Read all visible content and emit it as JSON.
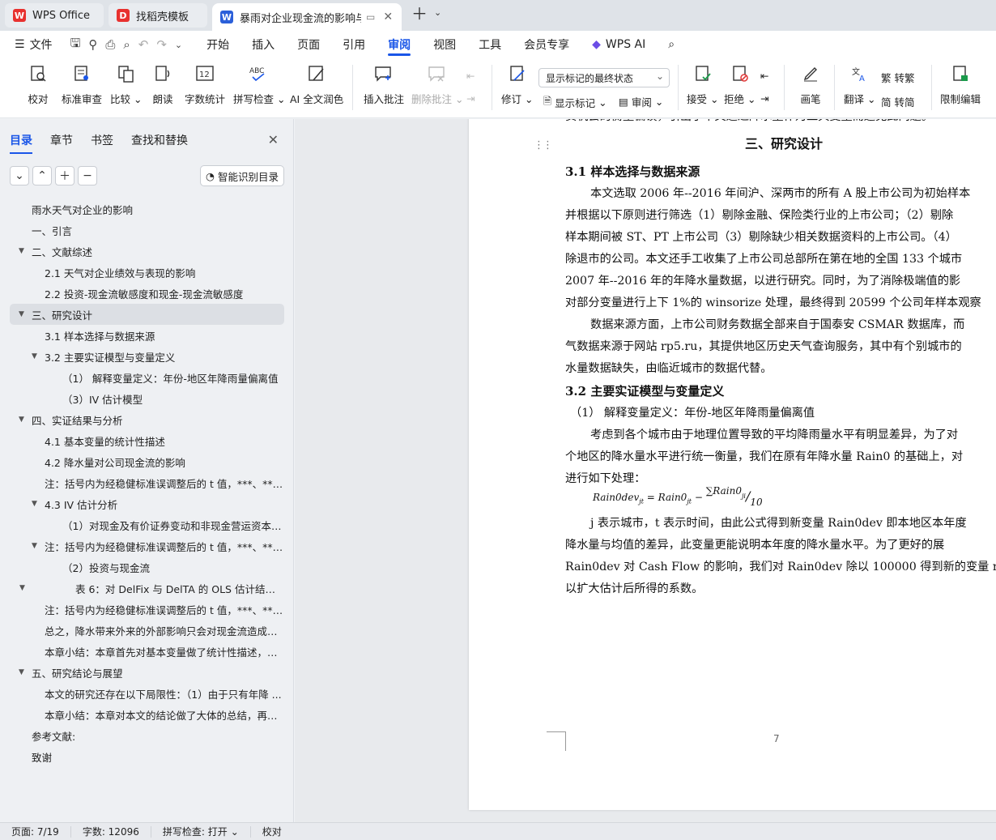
{
  "tabs": [
    {
      "label": "WPS Office",
      "icon": "wps-logo",
      "color": "#e8312f"
    },
    {
      "label": "找稻壳模板",
      "icon": "docer-logo",
      "color": "#e8312f"
    },
    {
      "label": "暴雨对企业现金流的影响与企",
      "icon": "word-doc",
      "color": "#2b5fd9"
    }
  ],
  "menu": {
    "file": "文件",
    "items": [
      "开始",
      "插入",
      "页面",
      "引用",
      "审阅",
      "视图",
      "工具",
      "会员专享"
    ],
    "active": "审阅",
    "wps_ai": "WPS AI"
  },
  "ribbon": {
    "proofread": "校对",
    "standard_review": "标准审查",
    "compare": "比较",
    "read_aloud": "朗读",
    "word_count": "字数统计",
    "spell_check": "拼写检查",
    "ai_polish": "AI 全文润色",
    "insert_comment": "插入批注",
    "delete_comment": "删除批注",
    "track": "修订",
    "markup_select": "显示标记的最终状态",
    "show_markup": "显示标记",
    "review": "审阅",
    "accept": "接受",
    "reject": "拒绝",
    "pen": "画笔",
    "translate": "翻译",
    "to_traditional": "转繁",
    "to_simplified": "转简",
    "restrict_edit": "限制编辑",
    "more": "文"
  },
  "panel": {
    "tabs": [
      "目录",
      "章节",
      "书签",
      "查找和替换"
    ],
    "active_tab": "目录",
    "smart_toc": "智能识别目录",
    "toc": [
      {
        "text": "雨水天气对企业的影响",
        "level": 0,
        "arrow": ""
      },
      {
        "text": "一、引言",
        "level": 0,
        "arrow": ""
      },
      {
        "text": "二、文献综述",
        "level": 0,
        "arrow": "down"
      },
      {
        "text": "2.1 天气对企业绩效与表现的影响",
        "level": 1,
        "arrow": ""
      },
      {
        "text": "2.2 投资-现金流敏感度和现金-现金流敏感度",
        "level": 1,
        "arrow": ""
      },
      {
        "text": "三、研究设计",
        "level": 0,
        "arrow": "down",
        "selected": true
      },
      {
        "text": "3.1  样本选择与数据来源",
        "level": 1,
        "arrow": ""
      },
      {
        "text": "3.2  主要实证模型与变量定义",
        "level": 1,
        "arrow": "down"
      },
      {
        "text": "（1）  解释变量定义：年份-地区年降雨量偏离值",
        "level": 2,
        "arrow": ""
      },
      {
        "text": "（3）IV 估计模型",
        "level": 2,
        "arrow": ""
      },
      {
        "text": "四、实证结果与分析",
        "level": 0,
        "arrow": "down"
      },
      {
        "text": "4.1 基本变量的统计性描述",
        "level": 1,
        "arrow": ""
      },
      {
        "text": "4.2 降水量对公司现金流的影响",
        "level": 1,
        "arrow": ""
      },
      {
        "text": "注：括号内为经稳健标准误调整后的 t 值，***、** ...",
        "level": 1,
        "arrow": ""
      },
      {
        "text": "4.3 IV 估计分析",
        "level": 1,
        "arrow": "down"
      },
      {
        "text": "（1）对现金及有价证券变动和非现金营运资本变 ...",
        "level": 2,
        "arrow": ""
      },
      {
        "text": "注：括号内为经稳健标准误调整后的 t 值，***、** ...",
        "level": 1,
        "arrow": "down"
      },
      {
        "text": "（2）投资与现金流",
        "level": 2,
        "arrow": ""
      },
      {
        "text": "表 6：对 DelFix 与 DelTA 的 OLS 估计结果 ...",
        "level": 3,
        "arrow": "down-far"
      },
      {
        "text": "注：括号内为经稳健标准误调整后的 t 值，***、** ...",
        "level": 1,
        "arrow": ""
      },
      {
        "text": "总之，降水带来外来的外部影响只会对现金流造成正 ...",
        "level": 1,
        "arrow": ""
      },
      {
        "text": "本章小结：本章首先对基本变量做了统计性描述，之 ...",
        "level": 1,
        "arrow": ""
      },
      {
        "text": "五、研究结论与展望",
        "level": 0,
        "arrow": "down"
      },
      {
        "text": "本文的研究还存在以下局限性：（1）由于只有年降 ...",
        "level": 1,
        "arrow": ""
      },
      {
        "text": "本章小结：本章对本文的结论做了大体的总结，再次 ...",
        "level": 1,
        "arrow": ""
      },
      {
        "text": "参考文献:",
        "level": 0,
        "arrow": ""
      },
      {
        "text": "致谢",
        "level": 0,
        "arrow": ""
      }
    ]
  },
  "doc": {
    "top_cut": "货机会的衡量偏误，引出了本文通过降水量作为工具变量而避免此问题。",
    "h_chapter": "三、研究设计",
    "h31": "3.1 样本选择与数据来源",
    "p1": [
      "本文选取 2006 年--2016 年间沪、深两市的所有 A 股上市公司为初始样本",
      "并根据以下原则进行筛选（1）剔除金融、保险类行业的上市公司；（2）剔除",
      "样本期间被 ST、PT 上市公司（3）剔除缺少相关数据资料的上市公司。（4）",
      "除退市的公司。本文还手工收集了上市公司总部所在第在地的全国 133 个城市",
      "2007 年--2016 年的年降水量数据，以进行研究。同时，为了消除极端值的影",
      "对部分变量进行上下 1%的 winsorize 处理，最终得到 20599 个公司年样本观察"
    ],
    "p2": [
      "数据来源方面，上市公司财务数据全部来自于国泰安 CSMAR 数据库，而",
      "气数据来源于网站 rp5.ru，其提供地区历史天气查询服务，其中有个别城市的",
      "水量数据缺失，由临近城市的数据代替。"
    ],
    "h32": "3.2 主要实证模型与变量定义",
    "h_sub": "（1）  解释变量定义：年份-地区年降雨量偏离值",
    "p3": [
      "考虑到各个城市由于地理位置导致的平均降雨量水平有明显差异，为了对",
      "个地区的降水量水平进行统一衡量，我们在原有年降水量 Rain0 的基础上，对",
      "进行如下处理："
    ],
    "formula_left": "Rain0dev",
    "formula_mid": "= Rain0",
    "formula_sum": "∑Rain0",
    "formula_den": "10",
    "formula_sub_jt": "jt",
    "formula_sub_ji": "ji",
    "p4": [
      "j 表示城市，t 表示时间，由此公式得到新变量 Rain0dev 即本地区本年度",
      "降水量与均值的差异，此变量更能说明本年度的降水量水平。为了更好的展",
      "Rain0dev 对 Cash Flow 的影响，我们对 Rain0dev 除以 100000 得到新的变量 r",
      "以扩大估计后所得的系数。"
    ],
    "page_number": "7"
  },
  "status": {
    "page": "页面: 7/19",
    "words": "字数: 12096",
    "spell": "拼写检查: 打开",
    "proof": "校对"
  },
  "colors": {
    "accent": "#1a56e8",
    "wps_red": "#e8312f",
    "doc_blue": "#2b5fd9"
  }
}
